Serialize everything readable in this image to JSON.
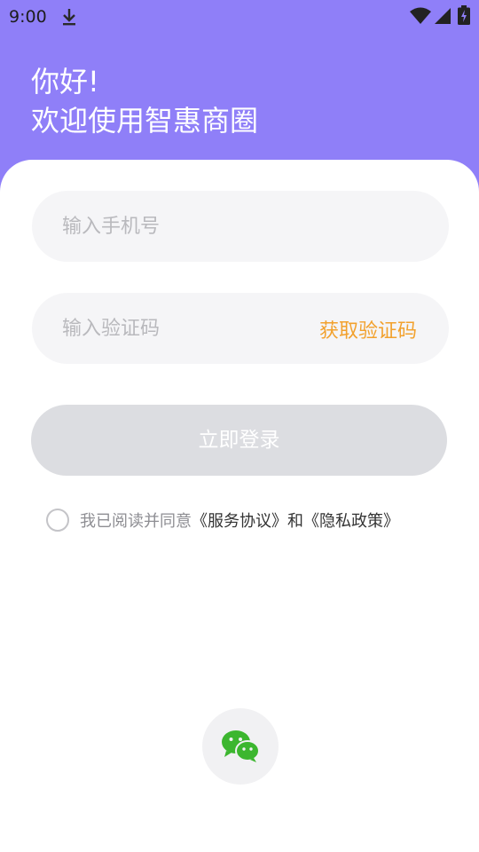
{
  "status_bar": {
    "time": "9:00"
  },
  "header": {
    "greeting_line1": "你好!",
    "greeting_line2": "欢迎使用智惠商圈"
  },
  "form": {
    "phone_placeholder": "输入手机号",
    "code_placeholder": "输入验证码",
    "get_code_label": "获取验证码",
    "login_label": "立即登录"
  },
  "agreement": {
    "prefix": "我已阅读并同意",
    "service_link": "《服务协议》",
    "conjunction": "和",
    "privacy_link": "《隐私政策》",
    "checked": false
  },
  "colors": {
    "header_bg": "#8f7ff8",
    "accent_orange": "#f2a12d",
    "button_disabled": "#dcdde1",
    "wechat_green": "#3cb62f"
  },
  "icons": {
    "download": "download-icon",
    "wifi": "wifi-icon",
    "signal": "signal-icon",
    "battery": "battery-icon",
    "wechat": "wechat-icon"
  }
}
